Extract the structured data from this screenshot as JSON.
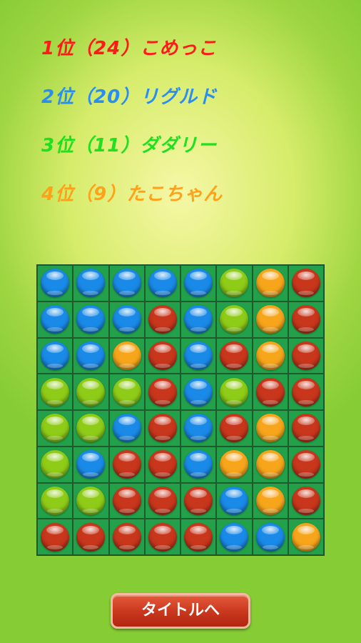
{
  "ranking": [
    {
      "text": "1位（24）こめっこ",
      "color": "#ff1a1a"
    },
    {
      "text": "2位（20）リグルド",
      "color": "#2a8df0"
    },
    {
      "text": "3位（11）ダダリー",
      "color": "#1fe01f"
    },
    {
      "text": "4位（9）たこちゃん",
      "color": "#ffa21a"
    }
  ],
  "ball_colors": {
    "B": "#1a8ae8",
    "G": "#8fcc17",
    "O": "#f7a51b",
    "R": "#c8361c"
  },
  "board": [
    [
      "B",
      "B",
      "B",
      "B",
      "B",
      "G",
      "O",
      "R"
    ],
    [
      "B",
      "B",
      "B",
      "R",
      "B",
      "G",
      "O",
      "R"
    ],
    [
      "B",
      "B",
      "O",
      "R",
      "B",
      "R",
      "O",
      "R"
    ],
    [
      "G",
      "G",
      "G",
      "R",
      "B",
      "G",
      "R",
      "R"
    ],
    [
      "G",
      "G",
      "B",
      "R",
      "B",
      "R",
      "O",
      "R"
    ],
    [
      "G",
      "B",
      "R",
      "R",
      "B",
      "O",
      "O",
      "R"
    ],
    [
      "G",
      "G",
      "R",
      "R",
      "R",
      "B",
      "O",
      "R"
    ],
    [
      "R",
      "R",
      "R",
      "R",
      "R",
      "B",
      "B",
      "O"
    ]
  ],
  "button": {
    "label": "タイトルへ"
  }
}
